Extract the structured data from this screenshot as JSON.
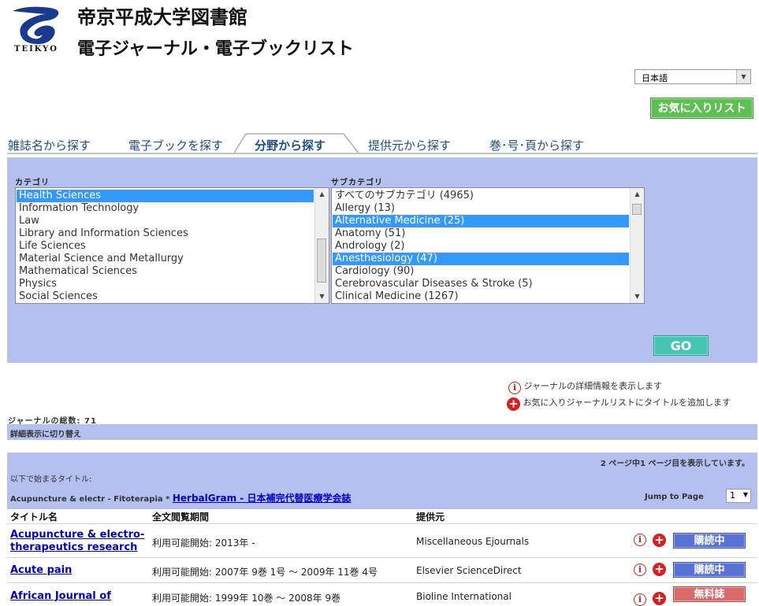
{
  "header": {
    "logo_text": "TEIKYO",
    "title": "帝京平成大学図書館",
    "subtitle": "電子ジャーナル・電子ブックリスト"
  },
  "language": {
    "selected": "日本語"
  },
  "favorites_button": "お気に入りリスト",
  "tabs": [
    {
      "label": "雑誌名から探す",
      "active": false
    },
    {
      "label": "電子ブックを探す",
      "active": false
    },
    {
      "label": "分野から探す",
      "active": true
    },
    {
      "label": "提供元から探す",
      "active": false
    },
    {
      "label": "巻･号･頁から探す",
      "active": false
    }
  ],
  "category": {
    "label": "カテゴリ",
    "items": [
      {
        "text": "Health Sciences",
        "selected": true
      },
      {
        "text": "Information Technology",
        "selected": false
      },
      {
        "text": "Law",
        "selected": false
      },
      {
        "text": "Library and Information Sciences",
        "selected": false
      },
      {
        "text": "Life Sciences",
        "selected": false
      },
      {
        "text": "Material Science and Metallurgy",
        "selected": false
      },
      {
        "text": "Mathematical Sciences",
        "selected": false
      },
      {
        "text": "Physics",
        "selected": false
      },
      {
        "text": "Social Sciences",
        "selected": false
      }
    ]
  },
  "subcategory": {
    "label": "サブカテゴリ",
    "items": [
      {
        "text": "すべてのサブカテゴリ (4965)",
        "selected": false
      },
      {
        "text": "Allergy (13)",
        "selected": false
      },
      {
        "text": "Alternative Medicine (25)",
        "selected": true
      },
      {
        "text": "Anatomy (51)",
        "selected": false
      },
      {
        "text": "Andrology (2)",
        "selected": false
      },
      {
        "text": "Anesthesiology (47)",
        "selected": true
      },
      {
        "text": "Cardiology (90)",
        "selected": false
      },
      {
        "text": "Cerebrovascular Diseases & Stroke (5)",
        "selected": false
      },
      {
        "text": "Clinical Medicine (1267)",
        "selected": false
      }
    ]
  },
  "go_button": "GO",
  "legend": {
    "info": "ジャーナルの詳細情報を表示します",
    "add": "お気に入りジャーナルリストにタイトルを追加します"
  },
  "total_label": "ジャーナルの総数: 71",
  "toggle_detail": "詳細表示に切り替え",
  "paging": {
    "status": "2 ページ中1 ページ目を表示しています。",
    "starts_with": "以下で始まるタイトル:",
    "range_text": "Acupuncture & electr - Fitoterapia *",
    "range_link": "HerbalGram - 日本補完代替医療学会誌",
    "jump_label": "Jump to Page",
    "page_value": "1"
  },
  "table": {
    "headers": {
      "title": "タイトル名",
      "period": "全文閲覧期間",
      "provider": "提供元"
    },
    "rows": [
      {
        "title_line1": "Acupuncture & electro-",
        "title_line2": "therapeutics research",
        "period": "利用可能開始: 2013年 -",
        "provider": "Miscellaneous Ejournals",
        "status": "購読中",
        "status_type": "subscribed"
      },
      {
        "title_line1": "Acute pain",
        "title_line2": "",
        "period": "利用可能開始: 2007年 9巻 1号 〜 2009年 11巻 4号",
        "provider": "Elsevier ScienceDirect",
        "status": "購読中",
        "status_type": "subscribed"
      },
      {
        "title_line1": "African Journal of",
        "title_line2": "",
        "period": "利用可能開始: 1999年 10巻 〜 2008年 9巻",
        "provider": "Bioline International",
        "status": "無料誌",
        "status_type": "free"
      }
    ]
  },
  "icons": {
    "info": "info-icon",
    "add": "add-favorite-icon"
  },
  "colors": {
    "panel": "#b4c0ef",
    "tab_text": "#1f4f86",
    "selection": "#3399ff",
    "fav_button": "#5fbf55",
    "go_button": "#46c6b2",
    "subscribed_button": "#5a72d6",
    "free_button": "#d96a6a"
  }
}
